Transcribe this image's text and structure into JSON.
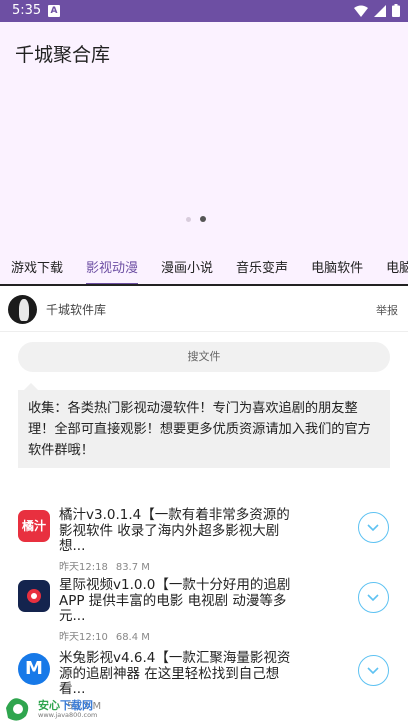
{
  "status_bar": {
    "time": "5:35",
    "notif_glyph": "A"
  },
  "app": {
    "title": "千城聚合库"
  },
  "carousel": {
    "page_count": 2,
    "active_index": 1
  },
  "tabs": [
    {
      "label": "游戏下载",
      "active": false
    },
    {
      "label": "影视动漫",
      "active": true
    },
    {
      "label": "漫画小说",
      "active": false
    },
    {
      "label": "音乐变声",
      "active": false
    },
    {
      "label": "电脑软件",
      "active": false
    },
    {
      "label": "电脑游",
      "active": false
    }
  ],
  "author": {
    "name": "千城软件库",
    "report_label": "举报"
  },
  "search": {
    "placeholder": "搜文件"
  },
  "notice": {
    "text": "收集：各类热门影视动漫软件！专门为喜欢追剧的朋友整理！全部可直接观影！想要更多优质资源请加入我们的官方软件群哦！"
  },
  "apps": [
    {
      "title": "橘汁v3.0.1.4【一款有着非常多资源的影视软件 收录了海内外超多影视大剧 想...",
      "time": "昨天12:18",
      "size": "83.7 M",
      "icon_text": "橘汁",
      "icon_color": "#e8303f"
    },
    {
      "title": "星际视频v1.0.0【一款十分好用的追剧APP 提供丰富的电影 电视剧 动漫等多元...",
      "time": "昨天12:10",
      "size": "68.4 M",
      "icon_text": "",
      "icon_color": "#14244e"
    },
    {
      "title": "米兔影视v4.6.4【一款汇聚海量影视资源的追剧神器 在这里轻松找到自己想看...",
      "time": "",
      "size": "53.2 M",
      "icon_text": "M",
      "icon_color": "#1779e8"
    }
  ],
  "watermark": {
    "brand_a": "安心",
    "brand_b": "下载网",
    "url": "www.java800.com"
  },
  "colors": {
    "accent": "#6d4fa3",
    "download": "#5ec2f2"
  }
}
